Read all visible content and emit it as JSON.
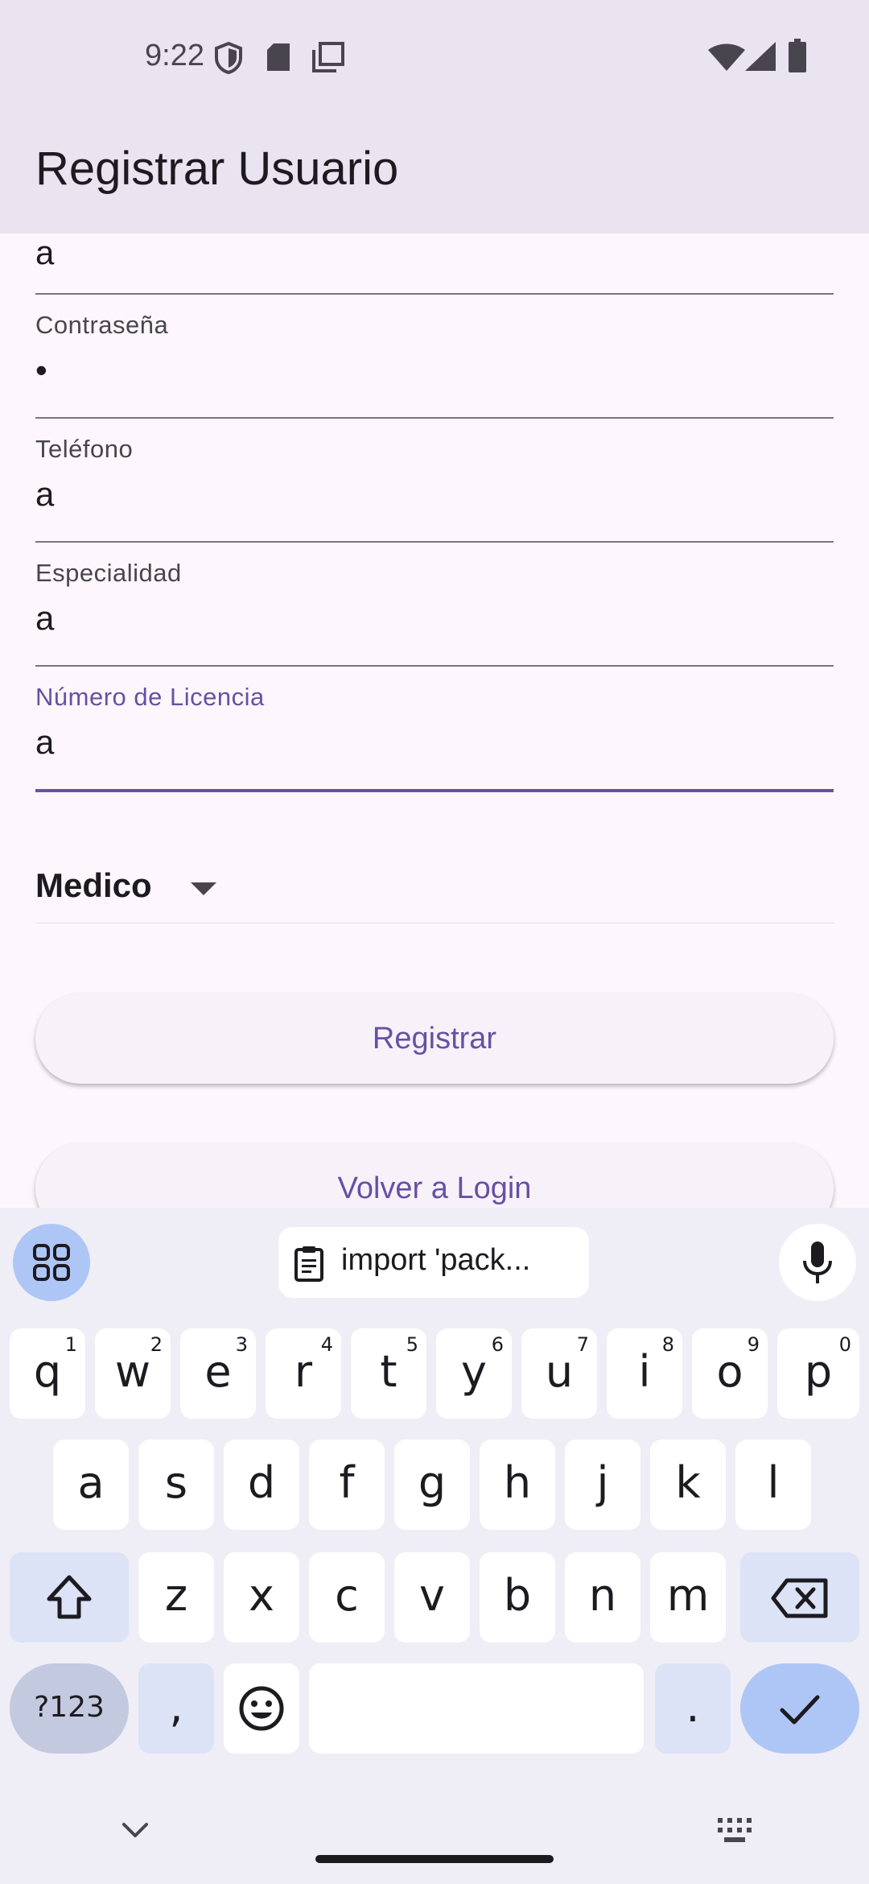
{
  "status_bar": {
    "time": "9:22"
  },
  "app_bar": {
    "title": "Registrar Usuario"
  },
  "form": {
    "top_field_value": "a",
    "fields": [
      {
        "label": "Contraseña",
        "value": "•"
      },
      {
        "label": "Teléfono",
        "value": "a"
      },
      {
        "label": "Especialidad",
        "value": "a"
      },
      {
        "label": "Número de Licencia",
        "value": "a"
      }
    ],
    "role_select": "Medico",
    "register_label": "Registrar",
    "back_label": "Volver a Login"
  },
  "keyboard": {
    "clipboard_text": "import 'pack...",
    "row1": [
      {
        "key": "q",
        "hint": "1"
      },
      {
        "key": "w",
        "hint": "2"
      },
      {
        "key": "e",
        "hint": "3"
      },
      {
        "key": "r",
        "hint": "4"
      },
      {
        "key": "t",
        "hint": "5"
      },
      {
        "key": "y",
        "hint": "6"
      },
      {
        "key": "u",
        "hint": "7"
      },
      {
        "key": "i",
        "hint": "8"
      },
      {
        "key": "o",
        "hint": "9"
      },
      {
        "key": "p",
        "hint": "0"
      }
    ],
    "row2": [
      "a",
      "s",
      "d",
      "f",
      "g",
      "h",
      "j",
      "k",
      "l"
    ],
    "row3": [
      "z",
      "x",
      "c",
      "v",
      "b",
      "n",
      "m"
    ],
    "symbols_label": "?123",
    "comma": ",",
    "period": "."
  }
}
